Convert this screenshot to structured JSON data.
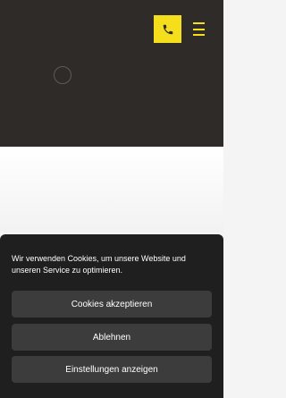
{
  "header": {
    "phone_icon": "phone-icon",
    "menu_icon": "hamburger-menu-icon",
    "accent_color": "#f5df1c",
    "background_color": "#2f2b28"
  },
  "loading_indicator": "spinner",
  "cookie_banner": {
    "message": "Wir verwenden Cookies, um unsere Website und unseren Service zu optimieren.",
    "accept_label": "Cookies akzeptieren",
    "decline_label": "Ablehnen",
    "settings_label": "Einstellungen anzeigen"
  }
}
